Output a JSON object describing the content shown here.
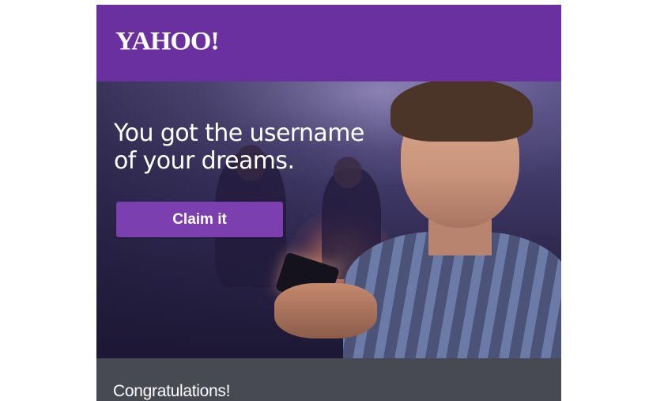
{
  "header": {
    "logo_text": "YAHOO!",
    "background_color": "#6b30a0"
  },
  "hero": {
    "headline_line1": "You got the username",
    "headline_line2": "of your dreams.",
    "cta_label": "Claim it",
    "cta_color": "#7b3fb0",
    "image_description": "man-smiling-at-phone-by-campfire"
  },
  "footer": {
    "title": "Congratulations!",
    "background_color": "#474a53"
  }
}
